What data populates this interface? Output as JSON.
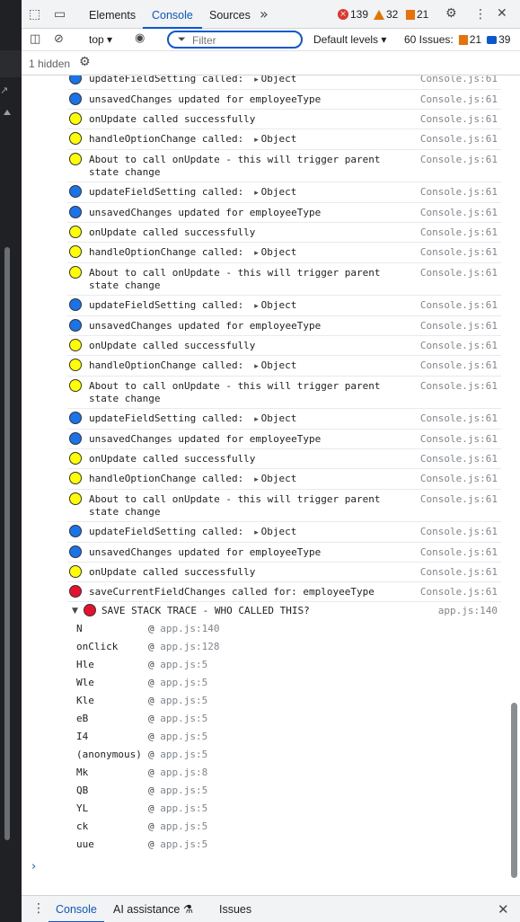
{
  "tabs": {
    "elements": "Elements",
    "console": "Console",
    "sources": "Sources",
    "more": "»"
  },
  "counts": {
    "errors": "139",
    "warnings": "32",
    "info": "21"
  },
  "toolbar": {
    "context": "top ▾",
    "filter_placeholder": "Filter",
    "levels": "Default levels ▾",
    "issues_label": "60 Issues:",
    "issues_warn": "21",
    "issues_info": "39"
  },
  "hidden": "1 hidden",
  "logs": [
    {
      "color": "blue",
      "text": "updateFieldSetting called:",
      "obj": "Object",
      "src": "Console.js:61"
    },
    {
      "color": "blue",
      "text": "unsavedChanges updated for employeeType",
      "src": "Console.js:61"
    },
    {
      "color": "yellow",
      "text": "onUpdate called successfully",
      "src": "Console.js:61"
    },
    {
      "color": "yellow",
      "text": "handleOptionChange called:",
      "obj": "Object",
      "src": "Console.js:61"
    },
    {
      "color": "yellow",
      "text": "About to call onUpdate - this will trigger parent state change",
      "src": "Console.js:61"
    },
    {
      "color": "blue",
      "text": "updateFieldSetting called:",
      "obj": "Object",
      "src": "Console.js:61"
    },
    {
      "color": "blue",
      "text": "unsavedChanges updated for employeeType",
      "src": "Console.js:61"
    },
    {
      "color": "yellow",
      "text": "onUpdate called successfully",
      "src": "Console.js:61"
    },
    {
      "color": "yellow",
      "text": "handleOptionChange called:",
      "obj": "Object",
      "src": "Console.js:61"
    },
    {
      "color": "yellow",
      "text": "About to call onUpdate - this will trigger parent state change",
      "src": "Console.js:61"
    },
    {
      "color": "blue",
      "text": "updateFieldSetting called:",
      "obj": "Object",
      "src": "Console.js:61"
    },
    {
      "color": "blue",
      "text": "unsavedChanges updated for employeeType",
      "src": "Console.js:61"
    },
    {
      "color": "yellow",
      "text": "onUpdate called successfully",
      "src": "Console.js:61"
    },
    {
      "color": "yellow",
      "text": "handleOptionChange called:",
      "obj": "Object",
      "src": "Console.js:61"
    },
    {
      "color": "yellow",
      "text": "About to call onUpdate - this will trigger parent state change",
      "src": "Console.js:61"
    },
    {
      "color": "blue",
      "text": "updateFieldSetting called:",
      "obj": "Object",
      "src": "Console.js:61"
    },
    {
      "color": "blue",
      "text": "unsavedChanges updated for employeeType",
      "src": "Console.js:61"
    },
    {
      "color": "yellow",
      "text": "onUpdate called successfully",
      "src": "Console.js:61"
    },
    {
      "color": "yellow",
      "text": "handleOptionChange called:",
      "obj": "Object",
      "src": "Console.js:61"
    },
    {
      "color": "yellow",
      "text": "About to call onUpdate - this will trigger parent state change",
      "src": "Console.js:61"
    },
    {
      "color": "blue",
      "text": "updateFieldSetting called:",
      "obj": "Object",
      "src": "Console.js:61"
    },
    {
      "color": "blue",
      "text": "unsavedChanges updated for employeeType",
      "src": "Console.js:61"
    },
    {
      "color": "yellow",
      "text": "onUpdate called successfully",
      "src": "Console.js:61"
    },
    {
      "color": "red",
      "text": "saveCurrentFieldChanges called for: employeeType",
      "src": "Console.js:61"
    }
  ],
  "trace": {
    "title": "SAVE STACK TRACE - WHO CALLED THIS?",
    "src": "app.js:140",
    "frames": [
      {
        "fn": "N",
        "loc": "app.js:140"
      },
      {
        "fn": "onClick",
        "loc": "app.js:128"
      },
      {
        "fn": "Hle",
        "loc": "app.js:5"
      },
      {
        "fn": "Wle",
        "loc": "app.js:5"
      },
      {
        "fn": "Kle",
        "loc": "app.js:5"
      },
      {
        "fn": "eB",
        "loc": "app.js:5"
      },
      {
        "fn": "I4",
        "loc": "app.js:5"
      },
      {
        "fn": "(anonymous)",
        "loc": "app.js:5"
      },
      {
        "fn": "Mk",
        "loc": "app.js:8"
      },
      {
        "fn": "QB",
        "loc": "app.js:5"
      },
      {
        "fn": "YL",
        "loc": "app.js:5"
      },
      {
        "fn": "ck",
        "loc": "app.js:5"
      },
      {
        "fn": "uue",
        "loc": "app.js:5"
      }
    ]
  },
  "drawer": {
    "console": "Console",
    "ai": "AI assistance ⚗",
    "issues": "Issues"
  },
  "colors": {
    "accent": "#0b57d0",
    "blue_badge": "#1a73e8",
    "yellow_badge": "#ffff00",
    "red_badge": "#e8112d"
  }
}
